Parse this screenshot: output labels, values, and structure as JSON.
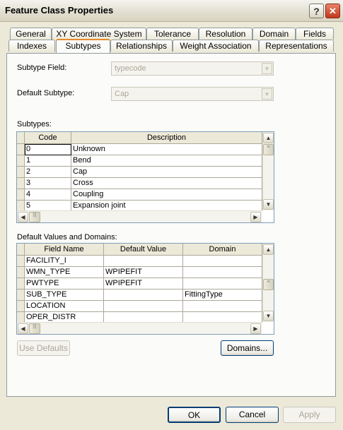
{
  "window": {
    "title": "Feature Class Properties",
    "help_symbol": "?",
    "close_symbol": "✕"
  },
  "tabs_row1": [
    "General",
    "XY Coordinate System",
    "Tolerance",
    "Resolution",
    "Domain",
    "Fields"
  ],
  "tabs_row2": [
    "Indexes",
    "Subtypes",
    "Relationships",
    "Weight Association",
    "Representations"
  ],
  "active_tab": "Subtypes",
  "subtype_field": {
    "label": "Subtype Field:",
    "value": "typecode"
  },
  "default_subtype": {
    "label": "Default Subtype:",
    "value": "Cap"
  },
  "subtypes": {
    "label": "Subtypes:",
    "headers": [
      "Code",
      "Description"
    ],
    "rows": [
      [
        "0",
        "Unknown"
      ],
      [
        "1",
        "Bend"
      ],
      [
        "2",
        "Cap"
      ],
      [
        "3",
        "Cross"
      ],
      [
        "4",
        "Coupling"
      ],
      [
        "5",
        "Expansion joint"
      ]
    ]
  },
  "defaults": {
    "label": "Default Values and Domains:",
    "headers": [
      "Field Name",
      "Default Value",
      "Domain"
    ],
    "rows": [
      [
        "FACILITY_I",
        "",
        ""
      ],
      [
        "WMN_TYPE",
        "WPIPEFIT",
        ""
      ],
      [
        "PWTYPE",
        "WPIPEFIT",
        ""
      ],
      [
        "SUB_TYPE",
        "",
        "FittingType"
      ],
      [
        "LOCATION",
        "",
        ""
      ],
      [
        "OPER_DISTR",
        "",
        ""
      ]
    ]
  },
  "buttons": {
    "use_defaults": "Use Defaults",
    "domains": "Domains...",
    "ok": "OK",
    "cancel": "Cancel",
    "apply": "Apply"
  },
  "icons": {
    "scroll_up": "▲",
    "scroll_down": "▼",
    "scroll_left": "◀",
    "scroll_right": "▶",
    "combo_arrow": "▼",
    "grip": "|||",
    "grip_h": "≡"
  }
}
